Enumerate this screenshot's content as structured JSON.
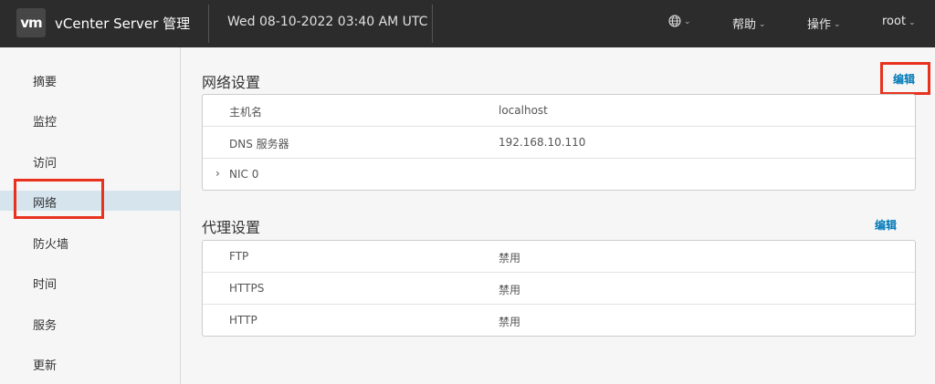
{
  "header": {
    "logo": "vm",
    "app_title": "vCenter Server 管理",
    "datetime": "Wed 08-10-2022 03:40 AM UTC",
    "menu": {
      "help": "帮助",
      "actions": "操作",
      "user": "root"
    },
    "icons": [
      "globe-icon",
      "chevron-down-icon"
    ]
  },
  "sidebar": {
    "items": [
      {
        "label": "摘要"
      },
      {
        "label": "监控"
      },
      {
        "label": "访问"
      },
      {
        "label": "网络",
        "active": true
      },
      {
        "label": "防火墙"
      },
      {
        "label": "时间"
      },
      {
        "label": "服务"
      },
      {
        "label": "更新"
      }
    ]
  },
  "network": {
    "title": "网络设置",
    "edit_label": "编辑",
    "rows": [
      {
        "key": "主机名",
        "value": "localhost"
      },
      {
        "key": "DNS 服务器",
        "value": "192.168.10.110"
      },
      {
        "key": "NIC 0",
        "value": "",
        "expandable": true
      }
    ]
  },
  "proxy": {
    "title": "代理设置",
    "edit_label": "编辑",
    "rows": [
      {
        "key": "FTP",
        "value": "禁用"
      },
      {
        "key": "HTTPS",
        "value": "禁用"
      },
      {
        "key": "HTTP",
        "value": "禁用"
      }
    ]
  },
  "colors": {
    "header_bg": "#2c2c2c",
    "accent_link": "#0079b8",
    "active_nav": "#d6e4ee",
    "highlight": "#e8321e"
  }
}
